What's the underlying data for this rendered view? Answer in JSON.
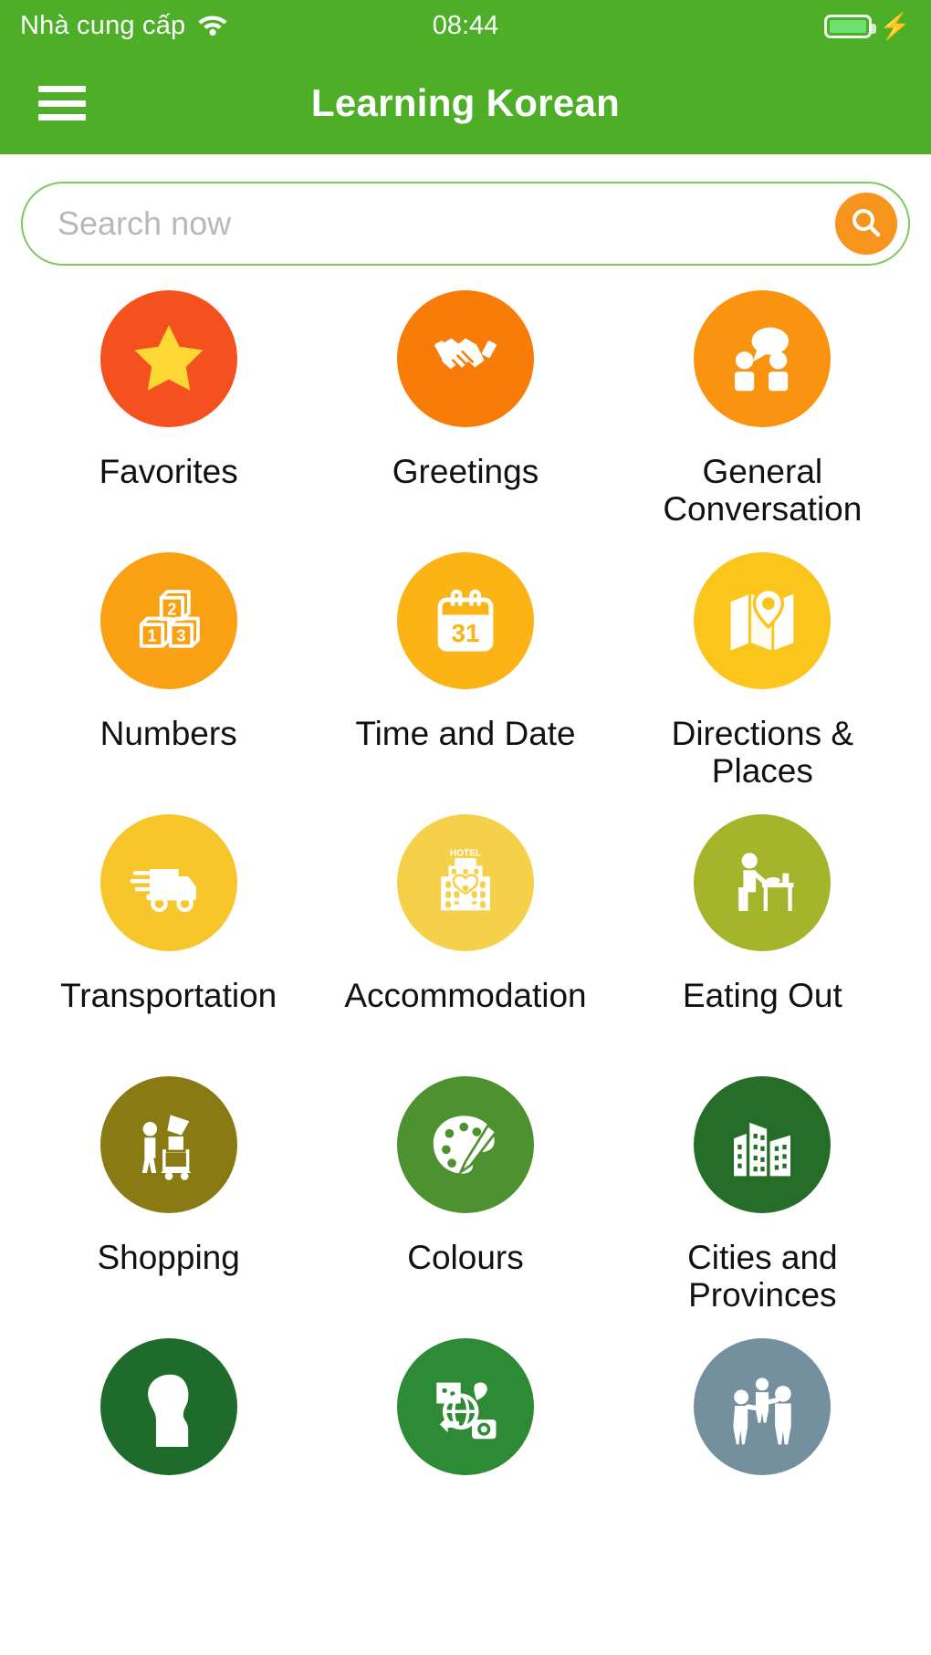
{
  "status_bar": {
    "carrier": "Nhà cung cấp",
    "wifi_icon": "wifi-icon",
    "time": "08:44",
    "battery_icon": "battery-icon",
    "charging_icon": "lightning-bolt-icon"
  },
  "app_bar": {
    "menu_icon": "hamburger-menu-icon",
    "title": "Learning Korean"
  },
  "search": {
    "value": "",
    "placeholder": "Search now",
    "button_icon": "search-icon",
    "button_color": "#F7941D",
    "border_color": "#7DC95B"
  },
  "theme": {
    "header_green": "#4CAF27",
    "page_background": "#FFFFFF",
    "label_color": "#111111"
  },
  "categories": [
    {
      "label": "Favorites",
      "icon": "star-icon",
      "color": "#F4511E",
      "glyph_color": "#FDD835"
    },
    {
      "label": "Greetings",
      "icon": "handshake-icon",
      "color": "#F97C08",
      "glyph_color": "#FFFFFF"
    },
    {
      "label": "General Conversation",
      "icon": "speech-people-icon",
      "color": "#FA9310",
      "glyph_color": "#FFFFFF"
    },
    {
      "label": "Numbers",
      "icon": "number-blocks-icon",
      "color": "#F9A112",
      "glyph_color": "#FFFFFF"
    },
    {
      "label": "Time and Date",
      "icon": "calendar-31-icon",
      "color": "#FBB315",
      "glyph_color": "#FFFFFF"
    },
    {
      "label": "Directions & Places",
      "icon": "map-pin-icon",
      "color": "#FBC51C",
      "glyph_color": "#FFFFFF"
    },
    {
      "label": "Transportation",
      "icon": "delivery-truck-icon",
      "color": "#F6C62B",
      "glyph_color": "#FFFFFF"
    },
    {
      "label": "Accommodation",
      "icon": "hotel-building-icon",
      "color": "#F7D04A",
      "glyph_color": "#FFFFFF"
    },
    {
      "label": "Eating Out",
      "icon": "dining-table-icon",
      "color": "#A4B42B",
      "glyph_color": "#FFFFFF"
    },
    {
      "label": "Shopping",
      "icon": "shopping-cart-icon",
      "color": "#8A7A13",
      "glyph_color": "#FFFFFF"
    },
    {
      "label": "Colours",
      "icon": "paint-palette-icon",
      "color": "#4E9130",
      "glyph_color": "#FFFFFF"
    },
    {
      "label": "Cities and Provinces",
      "icon": "city-buildings-icon",
      "color": "#256D28",
      "glyph_color": "#FFFFFF"
    },
    {
      "label": "",
      "icon": "person-profile-icon",
      "color": "#1E6B2B",
      "glyph_color": "#FFFFFF"
    },
    {
      "label": "",
      "icon": "travel-globe-icon",
      "color": "#2E8B35",
      "glyph_color": "#FFFFFF"
    },
    {
      "label": "",
      "icon": "family-people-icon",
      "color": "#74909F",
      "glyph_color": "#FFFFFF"
    }
  ]
}
